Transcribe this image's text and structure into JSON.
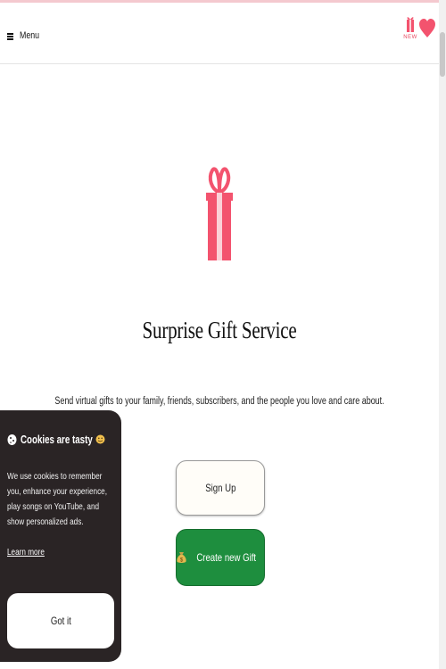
{
  "header": {
    "menu_label": "Menu",
    "new_badge_label": "NEW"
  },
  "hero": {
    "title": "Surprise Gift Service",
    "subtitle": "Send virtual gifts to your family, friends, subscribers, and the people you love and care about."
  },
  "actions": {
    "signup_label": "Sign Up",
    "create_label": "Create new Gift"
  },
  "cookie_banner": {
    "title": "Cookies are tasty",
    "body": "We use cookies to remember you, enhance your experience, play songs on YouTube, and show personalized ads.",
    "learn_more": "Learn more",
    "accept_label": "Got it"
  },
  "colors": {
    "accent_pink": "#f3536e",
    "create_green": "#1e8e3e",
    "cookie_bg": "#2a2425"
  },
  "icons": [
    "hamburger-icon",
    "gift-icon",
    "heart-icon",
    "cookie-icon",
    "smiley-cookie-icon",
    "money-bag-icon"
  ]
}
